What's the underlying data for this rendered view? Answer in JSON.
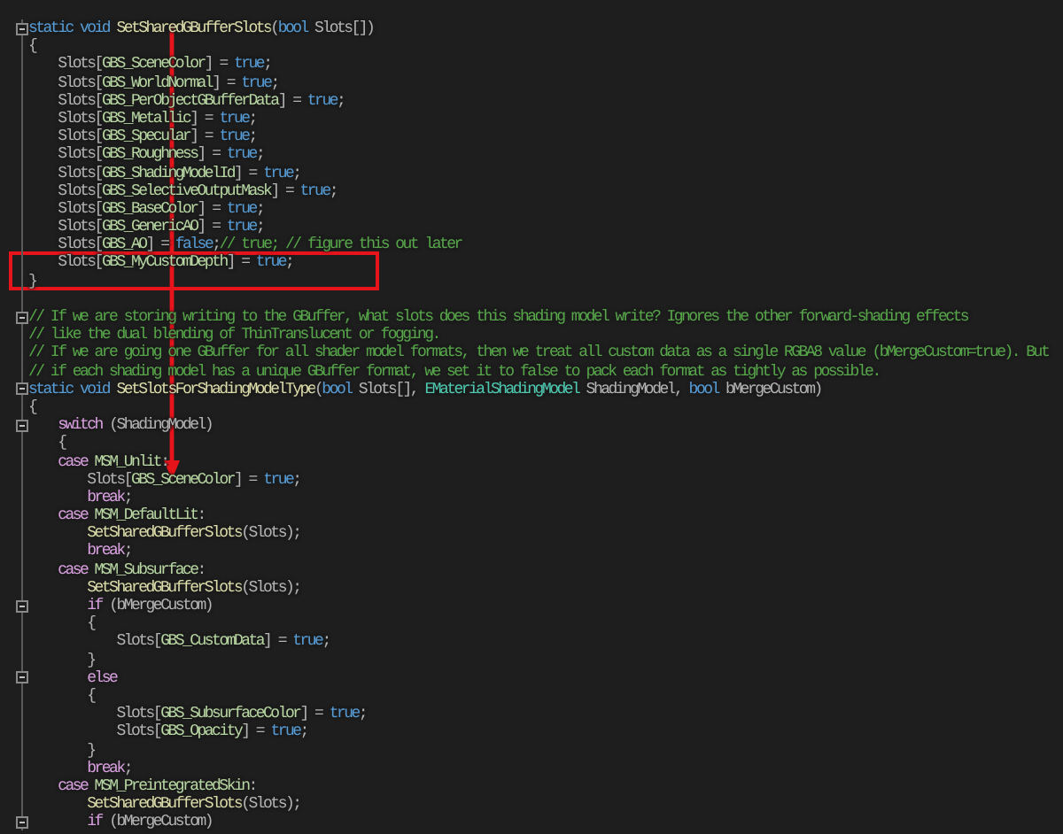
{
  "editor": {
    "lines": [
      {
        "kind": "code",
        "fold": true,
        "tokens": [
          {
            "kind": "kw",
            "text": "static void "
          },
          {
            "kind": "fn",
            "text": "SetSharedGBufferSlots"
          },
          {
            "kind": "plain",
            "text": "("
          },
          {
            "kind": "kw",
            "text": "bool "
          },
          {
            "kind": "param",
            "text": "Slots"
          },
          {
            "kind": "plain",
            "text": "[])"
          }
        ]
      },
      {
        "kind": "code",
        "fold": false,
        "tokens": [
          {
            "kind": "plain",
            "text": "{"
          }
        ]
      },
      {
        "kind": "code",
        "fold": false,
        "tokens": [
          {
            "kind": "param",
            "text": "    Slots"
          },
          {
            "kind": "plain",
            "text": "["
          },
          {
            "kind": "enum",
            "text": "GBS_SceneColor"
          },
          {
            "kind": "plain",
            "text": "] = "
          },
          {
            "kind": "kw",
            "text": "true"
          },
          {
            "kind": "plain",
            "text": ";"
          }
        ]
      },
      {
        "kind": "code",
        "fold": false,
        "tokens": [
          {
            "kind": "param",
            "text": "    Slots"
          },
          {
            "kind": "plain",
            "text": "["
          },
          {
            "kind": "enum",
            "text": "GBS_WorldNormal"
          },
          {
            "kind": "plain",
            "text": "] = "
          },
          {
            "kind": "kw",
            "text": "true"
          },
          {
            "kind": "plain",
            "text": ";"
          }
        ]
      },
      {
        "kind": "code",
        "fold": false,
        "tokens": [
          {
            "kind": "param",
            "text": "    Slots"
          },
          {
            "kind": "plain",
            "text": "["
          },
          {
            "kind": "enum",
            "text": "GBS_PerObjectGBufferData"
          },
          {
            "kind": "plain",
            "text": "] = "
          },
          {
            "kind": "kw",
            "text": "true"
          },
          {
            "kind": "plain",
            "text": ";"
          }
        ]
      },
      {
        "kind": "code",
        "fold": false,
        "tokens": [
          {
            "kind": "param",
            "text": "    Slots"
          },
          {
            "kind": "plain",
            "text": "["
          },
          {
            "kind": "enum",
            "text": "GBS_Metallic"
          },
          {
            "kind": "plain",
            "text": "] = "
          },
          {
            "kind": "kw",
            "text": "true"
          },
          {
            "kind": "plain",
            "text": ";"
          }
        ]
      },
      {
        "kind": "code",
        "fold": false,
        "tokens": [
          {
            "kind": "param",
            "text": "    Slots"
          },
          {
            "kind": "plain",
            "text": "["
          },
          {
            "kind": "enum",
            "text": "GBS_Specular"
          },
          {
            "kind": "plain",
            "text": "] = "
          },
          {
            "kind": "kw",
            "text": "true"
          },
          {
            "kind": "plain",
            "text": ";"
          }
        ]
      },
      {
        "kind": "code",
        "fold": false,
        "tokens": [
          {
            "kind": "param",
            "text": "    Slots"
          },
          {
            "kind": "plain",
            "text": "["
          },
          {
            "kind": "enum",
            "text": "GBS_Roughness"
          },
          {
            "kind": "plain",
            "text": "] = "
          },
          {
            "kind": "kw",
            "text": "true"
          },
          {
            "kind": "plain",
            "text": ";"
          }
        ]
      },
      {
        "kind": "code",
        "fold": false,
        "tokens": [
          {
            "kind": "param",
            "text": "    Slots"
          },
          {
            "kind": "plain",
            "text": "["
          },
          {
            "kind": "enum",
            "text": "GBS_ShadingModelId"
          },
          {
            "kind": "plain",
            "text": "] = "
          },
          {
            "kind": "kw",
            "text": "true"
          },
          {
            "kind": "plain",
            "text": ";"
          }
        ]
      },
      {
        "kind": "code",
        "fold": false,
        "tokens": [
          {
            "kind": "param",
            "text": "    Slots"
          },
          {
            "kind": "plain",
            "text": "["
          },
          {
            "kind": "enum",
            "text": "GBS_SelectiveOutputMask"
          },
          {
            "kind": "plain",
            "text": "] = "
          },
          {
            "kind": "kw",
            "text": "true"
          },
          {
            "kind": "plain",
            "text": ";"
          }
        ]
      },
      {
        "kind": "code",
        "fold": false,
        "tokens": [
          {
            "kind": "param",
            "text": "    Slots"
          },
          {
            "kind": "plain",
            "text": "["
          },
          {
            "kind": "enum",
            "text": "GBS_BaseColor"
          },
          {
            "kind": "plain",
            "text": "] = "
          },
          {
            "kind": "kw",
            "text": "true"
          },
          {
            "kind": "plain",
            "text": ";"
          }
        ]
      },
      {
        "kind": "code",
        "fold": false,
        "tokens": [
          {
            "kind": "param",
            "text": "    Slots"
          },
          {
            "kind": "plain",
            "text": "["
          },
          {
            "kind": "enum",
            "text": "GBS_GenericAO"
          },
          {
            "kind": "plain",
            "text": "] = "
          },
          {
            "kind": "kw",
            "text": "true"
          },
          {
            "kind": "plain",
            "text": ";"
          }
        ]
      },
      {
        "kind": "code",
        "fold": false,
        "tokens": [
          {
            "kind": "param",
            "text": "    Slots"
          },
          {
            "kind": "plain",
            "text": "["
          },
          {
            "kind": "enum",
            "text": "GBS_AO"
          },
          {
            "kind": "plain",
            "text": "] = "
          },
          {
            "kind": "kw",
            "text": "false"
          },
          {
            "kind": "plain",
            "text": ";"
          },
          {
            "kind": "comment",
            "text": "// true; // figure this out later"
          }
        ]
      },
      {
        "kind": "code",
        "fold": false,
        "tokens": [
          {
            "kind": "param",
            "text": "    Slots"
          },
          {
            "kind": "plain",
            "text": "["
          },
          {
            "kind": "enum",
            "text": "GBS_MyCustomDepth"
          },
          {
            "kind": "plain",
            "text": "] = "
          },
          {
            "kind": "kw",
            "text": "true"
          },
          {
            "kind": "plain",
            "text": ";"
          }
        ]
      },
      {
        "kind": "code",
        "fold": false,
        "tokens": [
          {
            "kind": "plain",
            "text": "}"
          }
        ]
      },
      {
        "kind": "blank",
        "fold": false
      },
      {
        "kind": "code",
        "fold": true,
        "tokens": [
          {
            "kind": "comment",
            "text": "// If we are storing writing to the GBuffer, what slots does this shading model write? Ignores the other forward-shading effects"
          }
        ]
      },
      {
        "kind": "code",
        "fold": false,
        "tokens": [
          {
            "kind": "comment",
            "text": "// like the dual blending of ThinTranslucent or fogging."
          }
        ]
      },
      {
        "kind": "code",
        "fold": false,
        "tokens": [
          {
            "kind": "comment",
            "text": "// If we are going one GBuffer for all shader model formats, then we treat all custom data as a single RGBA8 value (bMergeCustom=true). But"
          }
        ]
      },
      {
        "kind": "code",
        "fold": false,
        "tokens": [
          {
            "kind": "comment",
            "text": "// if each shading model has a unique GBuffer format, we set it to false to pack each format as tightly as possible."
          }
        ]
      },
      {
        "kind": "code",
        "fold": true,
        "tokens": [
          {
            "kind": "kw",
            "text": "static void "
          },
          {
            "kind": "fn",
            "text": "SetSlotsForShadingModelType"
          },
          {
            "kind": "plain",
            "text": "("
          },
          {
            "kind": "kw",
            "text": "bool "
          },
          {
            "kind": "param",
            "text": "Slots"
          },
          {
            "kind": "plain",
            "text": "[], "
          },
          {
            "kind": "type",
            "text": "EMaterialShadingModel "
          },
          {
            "kind": "param",
            "text": "ShadingModel"
          },
          {
            "kind": "plain",
            "text": ", "
          },
          {
            "kind": "kw",
            "text": "bool "
          },
          {
            "kind": "param",
            "text": "bMergeCustom"
          },
          {
            "kind": "plain",
            "text": ")"
          }
        ]
      },
      {
        "kind": "code",
        "fold": false,
        "tokens": [
          {
            "kind": "plain",
            "text": "{"
          }
        ]
      },
      {
        "kind": "code",
        "fold": true,
        "tokens": [
          {
            "kind": "ctl",
            "text": "    switch"
          },
          {
            "kind": "plain",
            "text": " ("
          },
          {
            "kind": "param",
            "text": "ShadingModel"
          },
          {
            "kind": "plain",
            "text": ")"
          }
        ]
      },
      {
        "kind": "code",
        "fold": false,
        "tokens": [
          {
            "kind": "plain",
            "text": "    {"
          }
        ]
      },
      {
        "kind": "code",
        "fold": false,
        "tokens": [
          {
            "kind": "ctl",
            "text": "    case "
          },
          {
            "kind": "enum",
            "text": "MSM_Unlit"
          },
          {
            "kind": "plain",
            "text": ":"
          }
        ]
      },
      {
        "kind": "code",
        "fold": false,
        "tokens": [
          {
            "kind": "param",
            "text": "        Slots"
          },
          {
            "kind": "plain",
            "text": "["
          },
          {
            "kind": "enum",
            "text": "GBS_SceneColor"
          },
          {
            "kind": "plain",
            "text": "] = "
          },
          {
            "kind": "kw",
            "text": "true"
          },
          {
            "kind": "plain",
            "text": ";"
          }
        ]
      },
      {
        "kind": "code",
        "fold": false,
        "tokens": [
          {
            "kind": "ctl",
            "text": "        break"
          },
          {
            "kind": "plain",
            "text": ";"
          }
        ]
      },
      {
        "kind": "code",
        "fold": false,
        "tokens": [
          {
            "kind": "ctl",
            "text": "    case "
          },
          {
            "kind": "enum",
            "text": "MSM_DefaultLit"
          },
          {
            "kind": "plain",
            "text": ":"
          }
        ]
      },
      {
        "kind": "code",
        "fold": false,
        "tokens": [
          {
            "kind": "fn",
            "text": "        SetSharedGBufferSlots"
          },
          {
            "kind": "plain",
            "text": "("
          },
          {
            "kind": "param",
            "text": "Slots"
          },
          {
            "kind": "plain",
            "text": ");"
          }
        ]
      },
      {
        "kind": "code",
        "fold": false,
        "tokens": [
          {
            "kind": "ctl",
            "text": "        break"
          },
          {
            "kind": "plain",
            "text": ";"
          }
        ]
      },
      {
        "kind": "code",
        "fold": false,
        "tokens": [
          {
            "kind": "ctl",
            "text": "    case "
          },
          {
            "kind": "enum",
            "text": "MSM_Subsurface"
          },
          {
            "kind": "plain",
            "text": ":"
          }
        ]
      },
      {
        "kind": "code",
        "fold": false,
        "tokens": [
          {
            "kind": "fn",
            "text": "        SetSharedGBufferSlots"
          },
          {
            "kind": "plain",
            "text": "("
          },
          {
            "kind": "param",
            "text": "Slots"
          },
          {
            "kind": "plain",
            "text": ");"
          }
        ]
      },
      {
        "kind": "code",
        "fold": true,
        "tokens": [
          {
            "kind": "ctl",
            "text": "        if"
          },
          {
            "kind": "plain",
            "text": " ("
          },
          {
            "kind": "param",
            "text": "bMergeCustom"
          },
          {
            "kind": "plain",
            "text": ")"
          }
        ]
      },
      {
        "kind": "code",
        "fold": false,
        "tokens": [
          {
            "kind": "plain",
            "text": "        {"
          }
        ]
      },
      {
        "kind": "code",
        "fold": false,
        "tokens": [
          {
            "kind": "param",
            "text": "            Slots"
          },
          {
            "kind": "plain",
            "text": "["
          },
          {
            "kind": "enum",
            "text": "GBS_CustomData"
          },
          {
            "kind": "plain",
            "text": "] = "
          },
          {
            "kind": "kw",
            "text": "true"
          },
          {
            "kind": "plain",
            "text": ";"
          }
        ]
      },
      {
        "kind": "code",
        "fold": false,
        "tokens": [
          {
            "kind": "plain",
            "text": "        }"
          }
        ]
      },
      {
        "kind": "code",
        "fold": true,
        "tokens": [
          {
            "kind": "ctl",
            "text": "        else"
          }
        ]
      },
      {
        "kind": "code",
        "fold": false,
        "tokens": [
          {
            "kind": "plain",
            "text": "        {"
          }
        ]
      },
      {
        "kind": "code",
        "fold": false,
        "tokens": [
          {
            "kind": "param",
            "text": "            Slots"
          },
          {
            "kind": "plain",
            "text": "["
          },
          {
            "kind": "enum",
            "text": "GBS_SubsurfaceColor"
          },
          {
            "kind": "plain",
            "text": "] = "
          },
          {
            "kind": "kw",
            "text": "true"
          },
          {
            "kind": "plain",
            "text": ";"
          }
        ]
      },
      {
        "kind": "code",
        "fold": false,
        "tokens": [
          {
            "kind": "param",
            "text": "            Slots"
          },
          {
            "kind": "plain",
            "text": "["
          },
          {
            "kind": "enum",
            "text": "GBS_Opacity"
          },
          {
            "kind": "plain",
            "text": "] = "
          },
          {
            "kind": "kw",
            "text": "true"
          },
          {
            "kind": "plain",
            "text": ";"
          }
        ]
      },
      {
        "kind": "code",
        "fold": false,
        "tokens": [
          {
            "kind": "plain",
            "text": "        }"
          }
        ]
      },
      {
        "kind": "code",
        "fold": false,
        "tokens": [
          {
            "kind": "ctl",
            "text": "        break"
          },
          {
            "kind": "plain",
            "text": ";"
          }
        ]
      },
      {
        "kind": "code",
        "fold": false,
        "tokens": [
          {
            "kind": "ctl",
            "text": "    case "
          },
          {
            "kind": "enum",
            "text": "MSM_PreintegratedSkin"
          },
          {
            "kind": "plain",
            "text": ":"
          }
        ]
      },
      {
        "kind": "code",
        "fold": false,
        "tokens": [
          {
            "kind": "fn",
            "text": "        SetSharedGBufferSlots"
          },
          {
            "kind": "plain",
            "text": "("
          },
          {
            "kind": "param",
            "text": "Slots"
          },
          {
            "kind": "plain",
            "text": ");"
          }
        ]
      },
      {
        "kind": "code",
        "fold": true,
        "tokens": [
          {
            "kind": "ctl",
            "text": "        if"
          },
          {
            "kind": "plain",
            "text": " ("
          },
          {
            "kind": "param",
            "text": "bMergeCustom"
          },
          {
            "kind": "plain",
            "text": ")"
          }
        ]
      }
    ]
  }
}
